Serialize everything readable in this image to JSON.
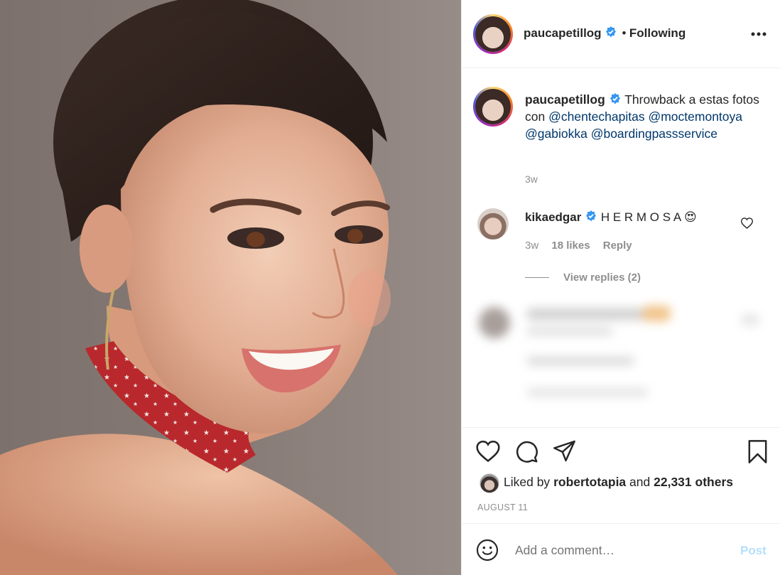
{
  "post": {
    "author": "paucapetillog",
    "follow_status": "Following",
    "separator": "•",
    "more_label": "•••"
  },
  "caption": {
    "author": "paucapetillog",
    "text": "Throwback a estas fotos con",
    "mentions": [
      "@chentechapitas",
      "@moctemontoya",
      "@gabiokka",
      "@boardingpassservice"
    ],
    "time": "3w"
  },
  "comment": {
    "author": "kikaedgar",
    "text": "H E R M O S A",
    "emoji": "😍",
    "time": "3w",
    "likes": "18 likes",
    "reply_label": "Reply",
    "view_replies": "View replies (2)"
  },
  "actions": {
    "like_icon": "heart-icon",
    "comment_icon": "comment-icon",
    "share_icon": "paper-plane-icon",
    "save_icon": "bookmark-icon"
  },
  "likes": {
    "prefix": "Liked by",
    "user": "robertotapia",
    "conj": "and",
    "others": "22,331 others"
  },
  "date": "AUGUST 11",
  "composer": {
    "placeholder": "Add a comment…",
    "post_label": "Post"
  },
  "colors": {
    "link": "#00376b",
    "muted": "#8e8e8e",
    "verified": "#3897f0",
    "post_button": "#b2dffc",
    "scarf": "#b8282c"
  }
}
